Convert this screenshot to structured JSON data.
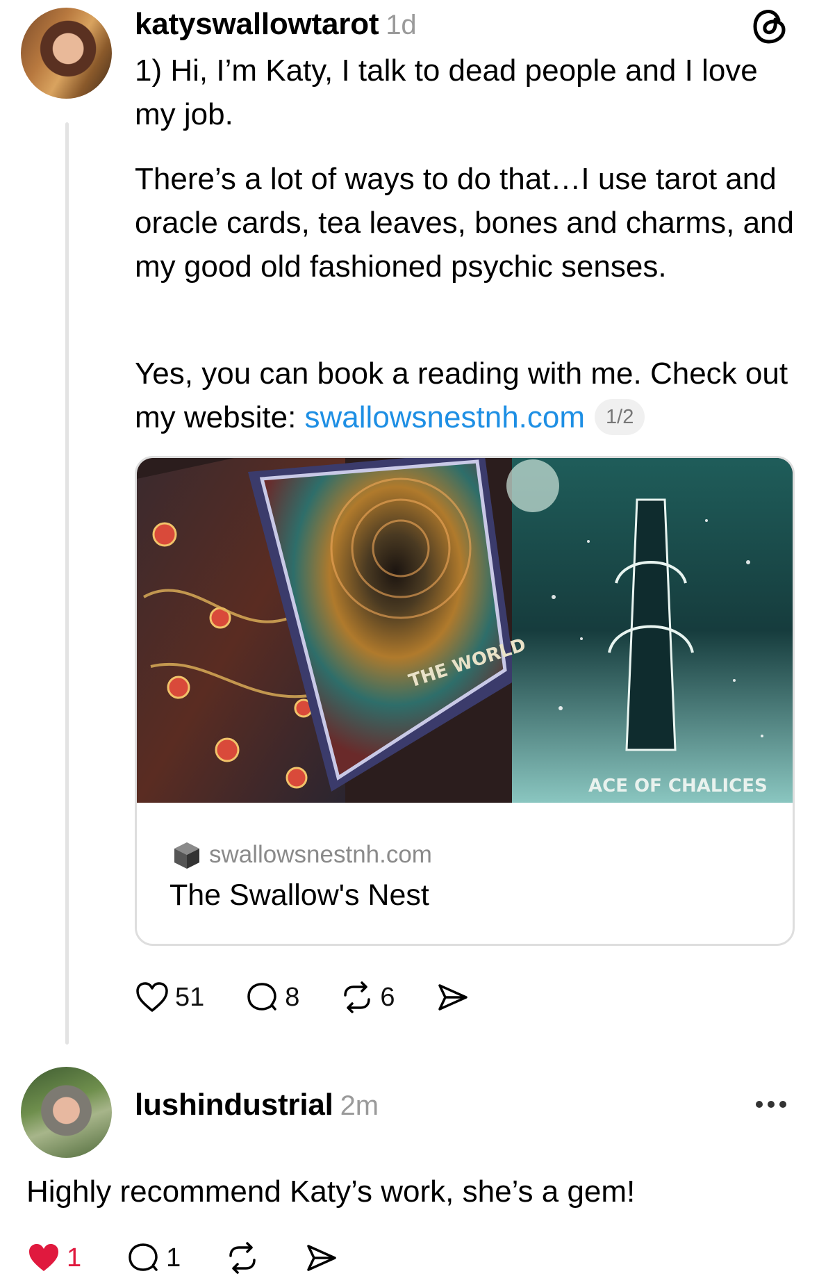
{
  "post": {
    "username": "katyswallowtarot",
    "time": "1d",
    "paragraph1": "1) Hi, I’m Katy, I talk to dead people and I love my job.",
    "paragraph2": "There’s a lot of ways to do that…I use tarot and oracle cards, tea leaves, bones and charms, and my good old fashioned psychic senses.",
    "paragraph3_text": "Yes, you can book a reading with me. Check out my website: ",
    "paragraph3_link": "swallowsnestnh.com",
    "page_counter": "1/2",
    "card": {
      "image_label_1": "THE WORLD",
      "image_label_2": "ACE OF CHALICES",
      "domain": "swallowsnestnh.com",
      "title": "The Swallow's Nest"
    },
    "actions": {
      "likes": "51",
      "replies": "8",
      "reposts": "6"
    },
    "icons": [
      "threads-logo-icon",
      "heart-icon",
      "comment-icon",
      "repost-icon",
      "share-icon"
    ]
  },
  "reply": {
    "username": "lushindustrial",
    "time": "2m",
    "text": "Highly recommend Katy’s work, she’s a gem!",
    "actions": {
      "likes": "1",
      "replies": "1"
    },
    "like_color": "#e0193e"
  },
  "colors": {
    "link": "#1e8fe4",
    "muted": "#9a9a9a"
  }
}
